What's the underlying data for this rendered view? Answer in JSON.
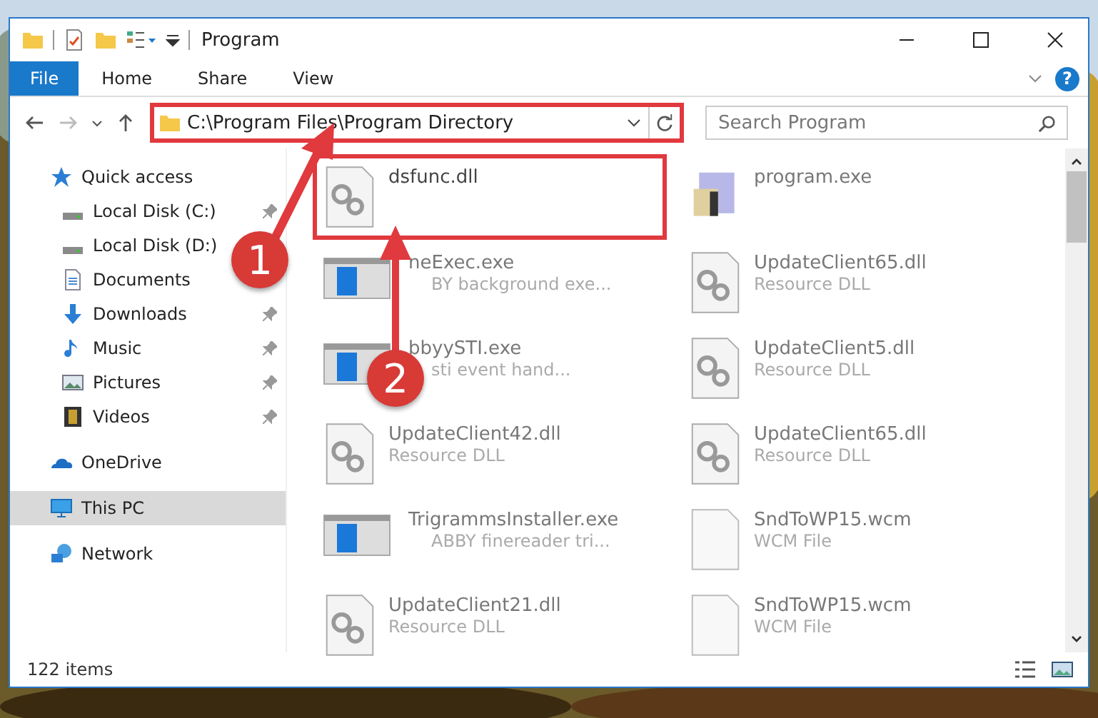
{
  "window": {
    "title": "Program"
  },
  "ribbon": {
    "tabs": [
      {
        "label": "File",
        "selected": true
      },
      {
        "label": "Home",
        "selected": false
      },
      {
        "label": "Share",
        "selected": false
      },
      {
        "label": "View",
        "selected": false
      }
    ],
    "help": "?"
  },
  "address": {
    "path": "C:\\Program Files\\Program Directory",
    "highlighted": true
  },
  "search": {
    "placeholder": "Search Program"
  },
  "sidebar": {
    "items": [
      {
        "label": "Quick access",
        "kind": "star",
        "selected": false,
        "children": [
          {
            "label": "Local Disk (C:)",
            "kind": "drive",
            "pinned": true,
            "selected": false
          },
          {
            "label": "Local Disk (D:)",
            "kind": "drive",
            "pinned": false,
            "selected": false
          },
          {
            "label": "Documents",
            "kind": "documents",
            "pinned": false,
            "selected": false
          },
          {
            "label": "Downloads",
            "kind": "downloads",
            "pinned": true,
            "selected": false
          },
          {
            "label": "Music",
            "kind": "music",
            "pinned": true,
            "selected": false
          },
          {
            "label": "Pictures",
            "kind": "pictures",
            "pinned": true,
            "selected": false
          },
          {
            "label": "Videos",
            "kind": "videos",
            "pinned": true,
            "selected": false
          }
        ]
      },
      {
        "label": "OneDrive",
        "kind": "cloud",
        "selected": false
      },
      {
        "label": "This PC",
        "kind": "pc",
        "selected": true
      },
      {
        "label": "Network",
        "kind": "network",
        "selected": false
      }
    ]
  },
  "files": [
    {
      "name": "dsfunc.dll",
      "kind": "dll",
      "highlighted": true
    },
    {
      "name": "program.exe",
      "kind": "program",
      "highlighted": false
    },
    {
      "name": "neExec.exe",
      "description": "BY background exe...",
      "kind": "exe",
      "highlighted": false
    },
    {
      "name": "UpdateClient65.dll",
      "description": "Resource DLL",
      "kind": "dll",
      "highlighted": false
    },
    {
      "name": "bbyySTI.exe",
      "description": "sti event hand...",
      "kind": "exe",
      "highlighted": false
    },
    {
      "name": "UpdateClient5.dll",
      "description": "Resource DLL",
      "kind": "dll",
      "highlighted": false
    },
    {
      "name": "UpdateClient42.dll",
      "description": "Resource DLL",
      "kind": "dll",
      "highlighted": false
    },
    {
      "name": "UpdateClient65.dll",
      "description": "Resource DLL",
      "kind": "dll",
      "highlighted": false
    },
    {
      "name": "TrigrammsInstaller.exe",
      "description": "ABBY finereader tri...",
      "kind": "exe",
      "highlighted": false
    },
    {
      "name": "SndToWP15.wcm",
      "description": "WCM File",
      "kind": "file",
      "highlighted": false
    },
    {
      "name": "UpdateClient21.dll",
      "description": "Resource DLL",
      "kind": "dll",
      "highlighted": false
    },
    {
      "name": "SndToWP15.wcm",
      "description": "WCM File",
      "kind": "file",
      "highlighted": false
    }
  ],
  "status_bar": {
    "count": "122 items"
  },
  "annotations": [
    {
      "label": "1"
    },
    {
      "label": "2"
    }
  ]
}
